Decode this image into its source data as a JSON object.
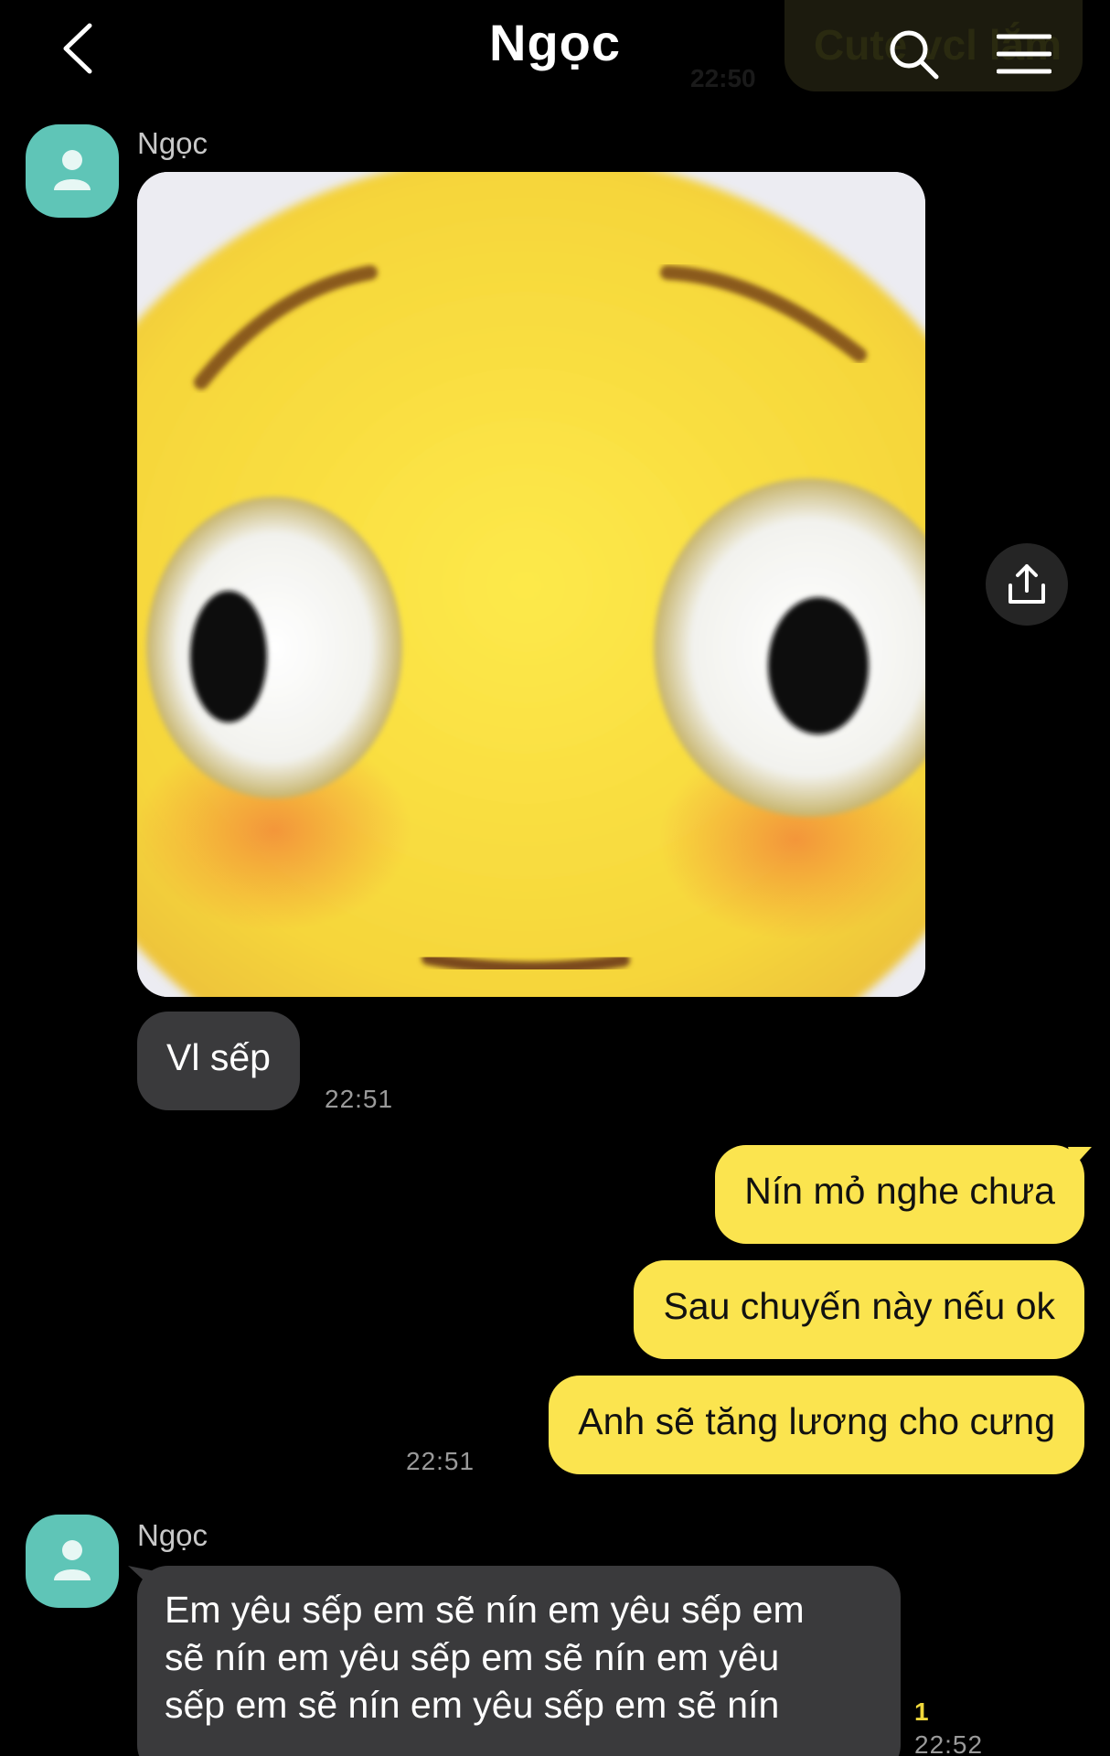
{
  "header": {
    "title": "Ngọc",
    "ghost_text": "Cute vcl lắm",
    "ghost_time": "22:50"
  },
  "messages": {
    "first": {
      "sender": "Ngọc",
      "image_alt": "blushing emoji",
      "text": "Vl sếp",
      "time": "22:51"
    },
    "outgoing": {
      "lines": [
        "Nín mỏ nghe chưa",
        "Sau chuyến này nếu ok",
        "Anh sẽ tăng lương cho cưng"
      ],
      "time": "22:51"
    },
    "last": {
      "sender": "Ngọc",
      "lines": [
        "Em yêu sếp em sẽ nín em yêu sếp em",
        "sẽ nín em yêu sếp em sẽ nín em yêu",
        "sếp em sẽ nín em yêu sếp em sẽ nín"
      ],
      "unread": "1",
      "time": "22:52"
    }
  },
  "icons": {
    "back": "chevron-left-icon",
    "search": "search-icon",
    "menu": "menu-icon",
    "share": "share-icon",
    "avatar": "person-icon"
  },
  "colors": {
    "background": "#000000",
    "outgoing_bubble": "#fbe44f",
    "incoming_bubble": "#3a3a3c",
    "avatar": "#5fc5b7",
    "unread": "#f0d83b"
  }
}
